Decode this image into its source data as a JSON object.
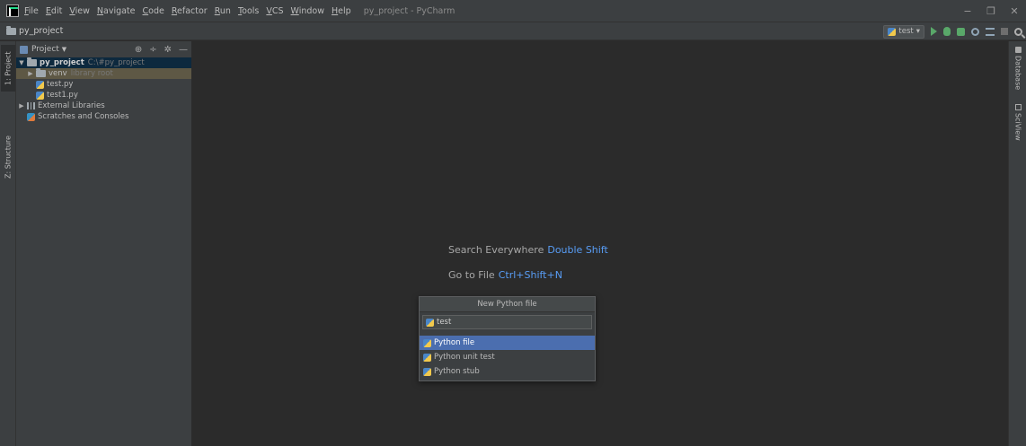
{
  "menu": {
    "items": [
      "File",
      "Edit",
      "View",
      "Navigate",
      "Code",
      "Refactor",
      "Run",
      "Tools",
      "VCS",
      "Window",
      "Help"
    ],
    "window_title": "py_project - PyCharm"
  },
  "window_controls": {
    "minimize": "−",
    "restore": "❐",
    "close": "✕"
  },
  "navbar": {
    "breadcrumb": "py_project",
    "run_config": "test"
  },
  "left_strip": {
    "project_tab": "1: Project",
    "structure_tab": "Z: Structure"
  },
  "project_panel": {
    "header": "Project",
    "tools": {
      "locate": "⊕",
      "collapse": "÷",
      "settings": "✲",
      "hide": "—"
    },
    "tree": {
      "root": {
        "name": "py_project",
        "path": "C:\\#py_project"
      },
      "venv": {
        "name": "venv",
        "note": "library root"
      },
      "files": [
        "test.py",
        "test1.py"
      ],
      "external": "External Libraries",
      "scratches": "Scratches and Consoles"
    }
  },
  "editor": {
    "hints": [
      {
        "label": "Search Everywhere",
        "key": "Double Shift"
      },
      {
        "label": "Go to File",
        "key": "Ctrl+Shift+N"
      }
    ]
  },
  "popup": {
    "title": "New Python file",
    "input_value": "test",
    "items": [
      "Python file",
      "Python unit test",
      "Python stub"
    ],
    "selected_index": 0
  },
  "right_strip": {
    "database": "Database",
    "sciview": "SciView"
  }
}
